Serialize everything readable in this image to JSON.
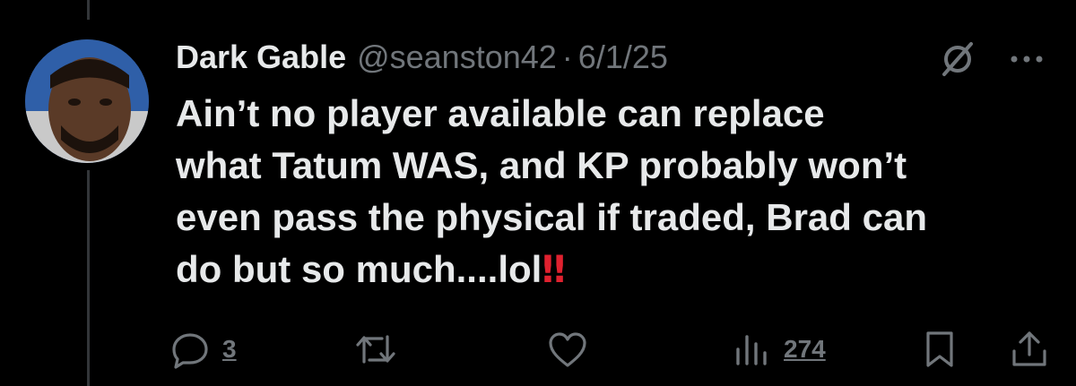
{
  "tweet": {
    "author_name": "Dark Gable",
    "handle": "@seanston42",
    "separator": "·",
    "date": "6/1/25",
    "text_lines": [
      "Ain’t no player available can replace",
      "what Tatum WAS, and KP probably won’t",
      "even pass the physical if traded, Brad can",
      "do but so much....lol"
    ],
    "emoji": "‼"
  },
  "actions": {
    "reply_count": "3",
    "retweet_count": "",
    "like_count": "",
    "views_count": "274"
  },
  "icons": {
    "header": [
      "grok-icon",
      "more-icon"
    ],
    "actions": [
      "reply-icon",
      "retweet-icon",
      "like-icon",
      "views-icon",
      "bookmark-icon",
      "share-icon"
    ]
  },
  "colors": {
    "background": "#000000",
    "text": "#e7e9ea",
    "muted": "#71767b",
    "emoji_red": "#e0212f",
    "thread_line": "#333639"
  }
}
